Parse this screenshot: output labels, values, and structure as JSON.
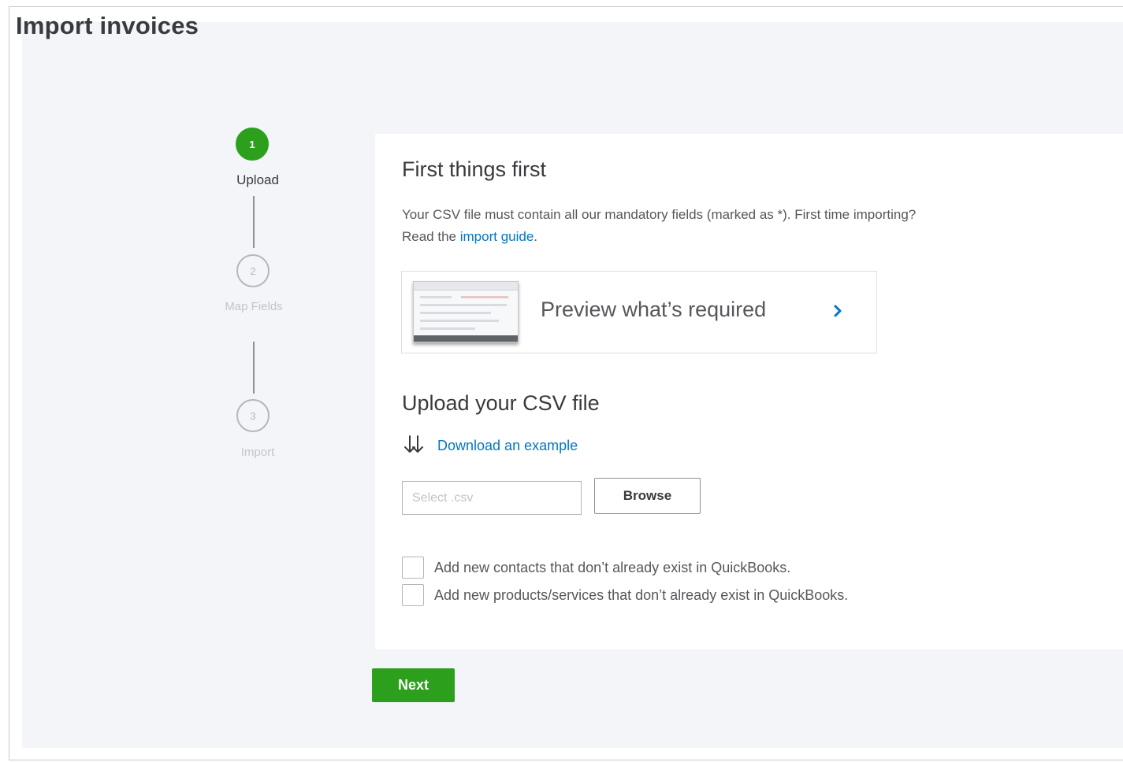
{
  "page": {
    "title": "Import invoices"
  },
  "stepper": {
    "steps": [
      {
        "number": "1",
        "label": "Upload",
        "state": "active"
      },
      {
        "number": "2",
        "label": "Map Fields",
        "state": "inactive"
      },
      {
        "number": "3",
        "label": "Import",
        "state": "inactive"
      }
    ]
  },
  "card": {
    "heading": "First things first",
    "description_part1": "Your CSV file must contain all our mandatory fields (marked as *). First time importing?",
    "description_part2": "Read the",
    "import_guide_link": "import guide",
    "description_end": ".",
    "preview_label": "Preview what’s required",
    "upload_heading": "Upload your CSV file",
    "download_link": "Download an example",
    "file_input_placeholder": "Select .csv",
    "browse_label": "Browse",
    "checkbox_contacts": "Add new contacts that don’t already exist in QuickBooks.",
    "checkbox_products": "Add new products/services that don’t already exist in QuickBooks."
  },
  "footer": {
    "next_label": "Next"
  },
  "colors": {
    "accent_green": "#2ca01c",
    "link_blue": "#0077c5",
    "page_background": "#f3f5f8"
  },
  "icons": {
    "preview": "chevron-right-icon",
    "download": "download-arrows-icon"
  }
}
